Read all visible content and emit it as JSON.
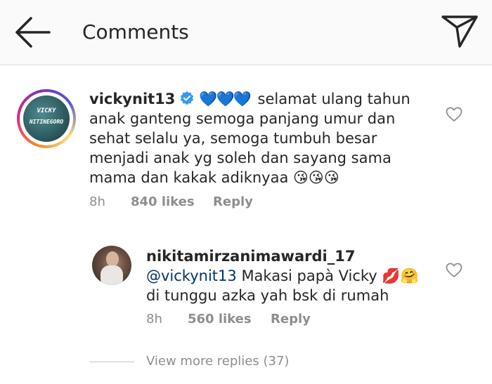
{
  "header": {
    "title": "Comments",
    "back_icon": "arrow-left-icon",
    "send_icon": "paper-plane-icon"
  },
  "comment": {
    "avatar_text_top": "VICKY",
    "avatar_text_bottom": "NITINEGORO",
    "username": "vickynit13",
    "verified_icon": "verified-badge-icon",
    "hearts": "💙💙💙",
    "text": "selamat ulang tahun anak ganteng semoga panjang umur dan sehat selalu ya, semoga tumbuh besar menjadi anak yg soleh dan sayang sama mama dan kakak adiknyaa",
    "emojis": "😘😘😘",
    "time": "8h",
    "likes": "840 likes",
    "reply_label": "Reply",
    "like_icon": "heart-outline-icon"
  },
  "reply": {
    "username": "nikitamirzanimawardi_17",
    "mention": "@vickynit13",
    "text_line1": "Makasi papà Vicky",
    "emojis": "💋🤗",
    "text_line2": "di tunggu azka yah bsk di rumah",
    "time": "8h",
    "likes": "560 likes",
    "reply_label": "Reply",
    "like_icon": "heart-outline-icon"
  },
  "view_more": {
    "label": "View more replies (37)"
  },
  "colors": {
    "header_bg": "#fafafa",
    "text": "#262626",
    "muted": "#8e8e8e",
    "mention": "#003569",
    "verified": "#3897f0"
  }
}
